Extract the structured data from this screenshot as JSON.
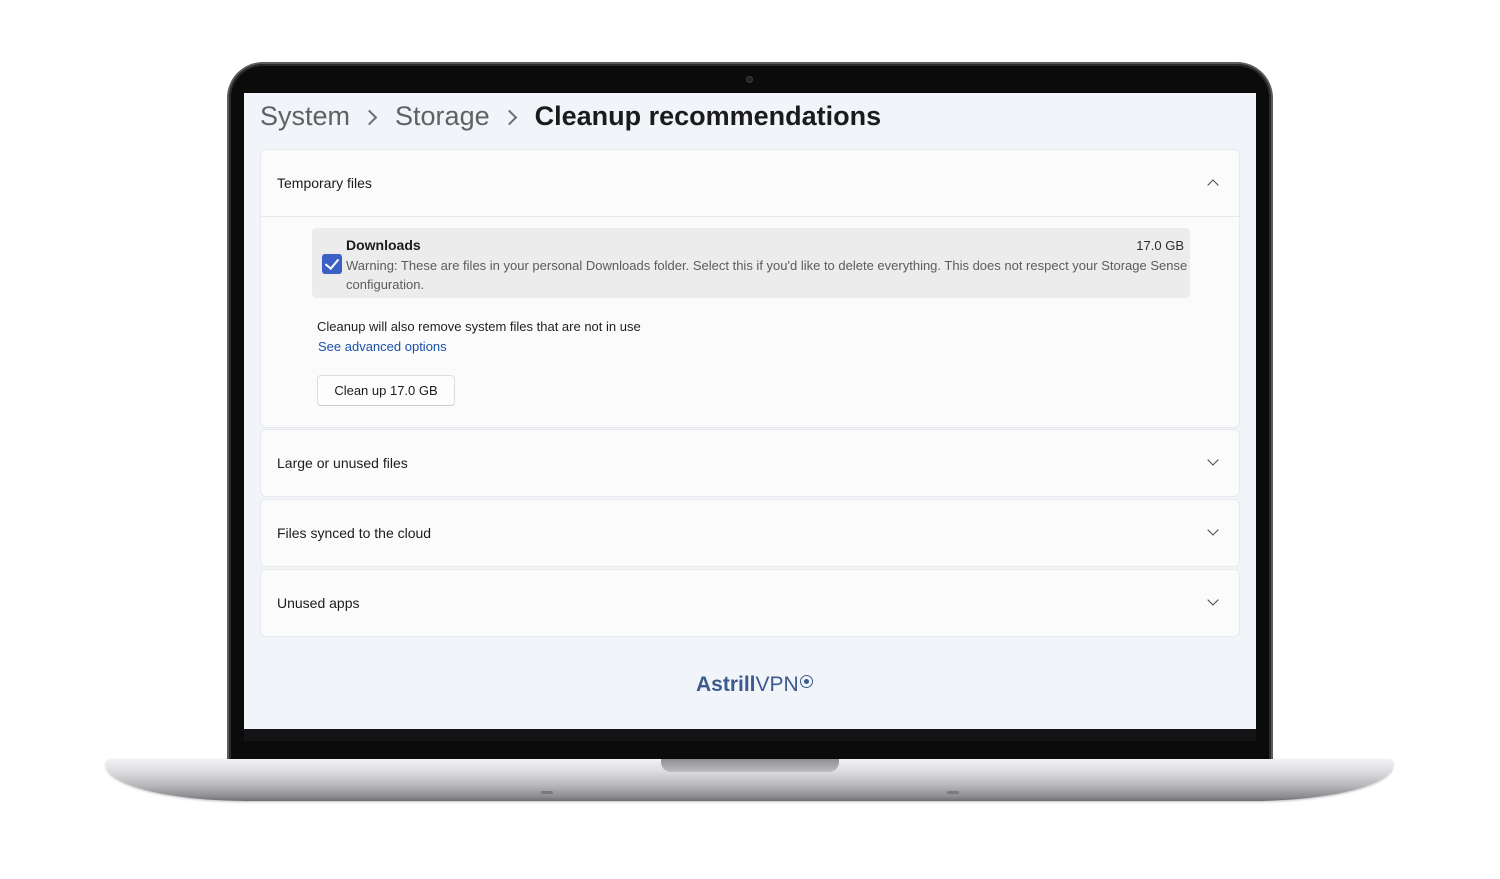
{
  "breadcrumb": {
    "items": [
      "System",
      "Storage"
    ],
    "current": "Cleanup recommendations"
  },
  "sections": {
    "temporary": {
      "title": "Temporary files",
      "expanded": true,
      "downloads": {
        "checked": true,
        "title": "Downloads",
        "size": "17.0 GB",
        "warning": "Warning: These are files in your personal Downloads folder. Select this if you'd like to delete everything. This does not respect your Storage Sense configuration."
      },
      "system_note": "Cleanup will also remove system files that are not in use",
      "advanced_link": "See advanced options",
      "cleanup_button": "Clean up 17.0 GB"
    },
    "large_unused": {
      "title": "Large or unused files",
      "expanded": false
    },
    "cloud": {
      "title": "Files synced to the cloud",
      "expanded": false
    },
    "unused_apps": {
      "title": "Unused apps",
      "expanded": false
    }
  },
  "brand": {
    "part1": "Astrill",
    "part2": "VPN",
    "mark_icon": "registered-mark-icon"
  },
  "colors": {
    "accent": "#3b5fc4",
    "link": "#1a52a8",
    "brand": "#3d5a8e",
    "screen_bg": "#f1f4f9"
  }
}
